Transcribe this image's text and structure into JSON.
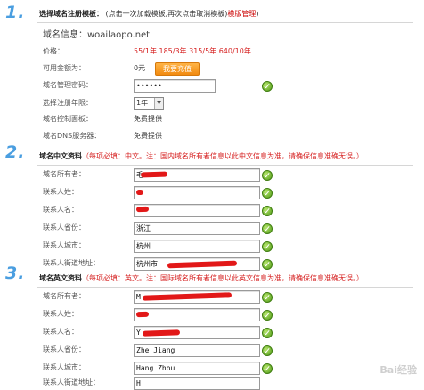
{
  "steps": {
    "s1": "1.",
    "s2": "2.",
    "s3": "3."
  },
  "section1": {
    "head_title": "选择域名注册模板：",
    "head_hint": "(点击一次加载模板,再次点击取消模板)",
    "head_link": "模版管理",
    "head_end": ")",
    "domain_info": "域名信息：woailaopo.net",
    "price_label": "价格：",
    "price_value": "55/1年  185/3年  315/5年  640/10年",
    "balance_label": "可用金额为：",
    "balance_value": "0元",
    "recharge_button": "我要充值",
    "password_label": "域名管理密码：",
    "password_value": "••••••",
    "years_label": "选择注册年限：",
    "years_value": "1年",
    "panel_label": "域名控制面板：",
    "panel_value": "免费提供",
    "dns_label": "域名DNS服务器：",
    "dns_value": "免费提供"
  },
  "section2": {
    "head_title": "域名中文资料",
    "head_note": "（每项必填：中文。注：国内域名所有者信息以此中文信息为准，请确保信息准确无误。）",
    "owner_label": "域名所有者：",
    "owner_value": "毛",
    "surname_label": "联系人姓：",
    "surname_value": "",
    "name_label": "联系人名：",
    "name_value": "",
    "province_label": "联系人省份：",
    "province_value": "浙江",
    "city_label": "联系人城市：",
    "city_value": "杭州",
    "address_label": "联系人街道地址：",
    "address_value": "杭州市"
  },
  "section3": {
    "head_title": "域名英文资料",
    "head_note": "（每项必填：英文。注：国际域名所有者信息以此英文信息为准，请确保信息准确无误。）",
    "owner_label": "域名所有者：",
    "owner_value": "M",
    "surname_label": "联系人姓：",
    "surname_value": "",
    "name_label": "联系人名：",
    "name_value": "Y",
    "province_label": "联系人省份：",
    "province_value": "Zhe Jiang",
    "city_label": "联系人城市：",
    "city_value": "Hang Zhou",
    "address_label": "联系人街道地址：",
    "address_value": "H"
  },
  "watermark": "Bai经验"
}
